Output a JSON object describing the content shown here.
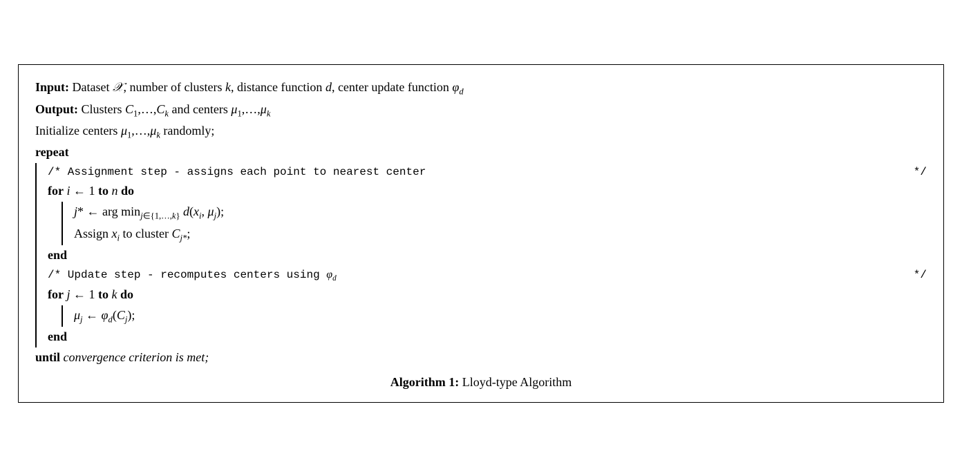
{
  "algorithm": {
    "title": "Algorithm 1:",
    "subtitle": "Lloyd-type Algorithm",
    "input_label": "Input:",
    "input_text": "Dataset 𝒳, number of clusters k, distance function d, center update function φ_d",
    "output_label": "Output:",
    "output_text": "Clusters C₁,…,C_k and centers μ₁,…,μ_k",
    "init_text": "Initialize centers μ₁,…,μ_k randomly;",
    "repeat_label": "repeat",
    "comment1": "/* Assignment step - assigns each point to nearest center",
    "comment1_end": "*/",
    "for1_label": "for",
    "for1_text": "i ← 1 to n do",
    "line_j": "j* ← arg min_{j∈{1,...,k}} d(x_i, μ_j);",
    "line_assign": "Assign x_i to cluster C_{j*};",
    "end1": "end",
    "comment2": "/* Update step - recomputes centers using φ_d",
    "comment2_end": "*/",
    "for2_label": "for",
    "for2_text": "j ← 1 to k do",
    "line_mu": "μ_j ← φ_d(C_j);",
    "end2": "end",
    "until_label": "until",
    "until_text": "convergence criterion is met;"
  }
}
